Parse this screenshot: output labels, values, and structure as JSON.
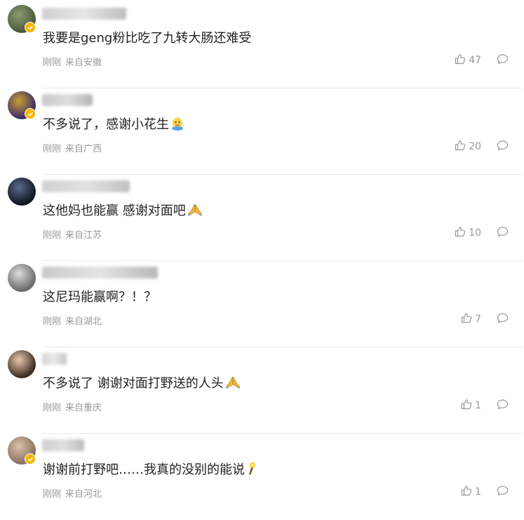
{
  "colors": {
    "accent": "#f7b500",
    "meta_text": "#999999",
    "body_text": "#222222",
    "divider": "#e8e8e8"
  },
  "comments": [
    {
      "text": "我要是geng粉比吃了九转大肠还难受",
      "emoji": "",
      "time": "刚刚",
      "location": "来自安徽",
      "likes": "47",
      "verified": true,
      "avatar_colors": [
        "#4a5a3a",
        "#8c9a6e"
      ],
      "name_blur_colors": [
        "#cfcfcf",
        "#e6e6e6",
        "#bdbdbd"
      ]
    },
    {
      "text": "不多说了，感谢小花生",
      "emoji": "peanut-face-emoji",
      "time": "刚刚",
      "location": "来自广西",
      "likes": "20",
      "verified": true,
      "avatar_colors": [
        "#3a2a6a",
        "#c8a030"
      ],
      "name_blur_colors": [
        "#c8c8c8",
        "#dedede",
        "#b5b5b5"
      ]
    },
    {
      "text": "这他妈也能赢 感谢对面吧",
      "emoji": "pray-emoji",
      "time": "刚刚",
      "location": "来自江苏",
      "likes": "10",
      "verified": false,
      "avatar_colors": [
        "#0e1420",
        "#5a6a8c"
      ],
      "name_blur_colors": [
        "#d0d0d0",
        "#e2e2e2",
        "#c0c0c0"
      ]
    },
    {
      "text": "这尼玛能赢啊？！？",
      "emoji": "",
      "time": "刚刚",
      "location": "来自湖北",
      "likes": "7",
      "verified": false,
      "avatar_colors": [
        "#6a6a6a",
        "#dcdcdc"
      ],
      "name_blur_colors": [
        "#c9c9c9",
        "#e4e4e4",
        "#b8b8b8"
      ]
    },
    {
      "text": "不多说了 谢谢对面打野送的人头",
      "emoji": "pray-emoji",
      "time": "刚刚",
      "location": "来自重庆",
      "likes": "1",
      "verified": false,
      "avatar_colors": [
        "#3a2a20",
        "#e8c8b0"
      ],
      "name_blur_colors": [
        "#d4d4d4",
        "#e8e8e8",
        "#c4c4c4"
      ]
    },
    {
      "text": "谢谢前打野吧……我真的没别的能说",
      "emoji": "torch-emoji",
      "time": "刚刚",
      "location": "来自河北",
      "likes": "1",
      "verified": true,
      "avatar_colors": [
        "#8a7060",
        "#d8c0a8"
      ],
      "name_blur_colors": [
        "#cecece",
        "#e0e0e0",
        "#bcbcbc"
      ]
    }
  ]
}
